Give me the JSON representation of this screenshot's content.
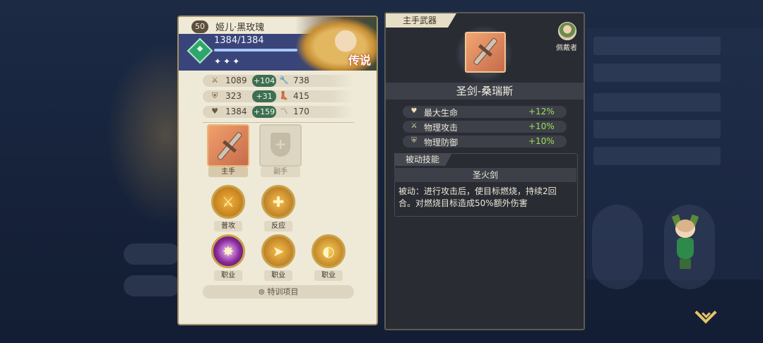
{
  "hero": {
    "level": "50",
    "name": "姬儿·黑玫瑰",
    "hp": "1384/1384",
    "hp_fraction": 1.0,
    "stars": "✦✦✦",
    "rarity": "传说"
  },
  "stats": [
    {
      "left_icon": "sword-icon",
      "left_value": "1089",
      "bonus": "+104",
      "right_icon": "wrench-icon",
      "right_value": "738"
    },
    {
      "left_icon": "shield-icon",
      "left_value": "323",
      "bonus": "+31",
      "right_icon": "boot-icon",
      "right_value": "415"
    },
    {
      "left_icon": "heart-icon",
      "left_value": "1384",
      "bonus": "+159",
      "right_icon": "wing-icon",
      "right_value": "170"
    }
  ],
  "equipment": {
    "main_label": "主手",
    "off_label": "副手"
  },
  "skills": [
    {
      "label": "普攻",
      "icon": "sword-swing-icon"
    },
    {
      "label": "反应",
      "icon": "holy-shield-icon"
    },
    {
      "label": "职业",
      "icon": "purple-burst-icon"
    },
    {
      "label": "职业",
      "icon": "lance-icon"
    },
    {
      "label": "职业",
      "icon": "swirl-icon"
    }
  ],
  "training_button": "特训项目",
  "weapon": {
    "slot_tag": "主手武器",
    "wearer_label": "佩戴者",
    "name": "圣剑-桑瑞斯",
    "attributes": [
      {
        "icon": "heart-icon",
        "name": "最大生命",
        "value": "+12%"
      },
      {
        "icon": "sword-icon",
        "name": "物理攻击",
        "value": "+10%"
      },
      {
        "icon": "shield-icon",
        "name": "物理防御",
        "value": "+10%"
      }
    ],
    "passive_tag": "被动技能",
    "passive_name": "圣火剑",
    "passive_desc": "被动：进行攻击后，使目标燃烧，持续2回合。对燃烧目标造成50%额外伤害"
  },
  "colors": {
    "bonus_green": "#3f6e52",
    "attr_value_green": "#9be05d",
    "skill_gold": "#c9a24a"
  }
}
